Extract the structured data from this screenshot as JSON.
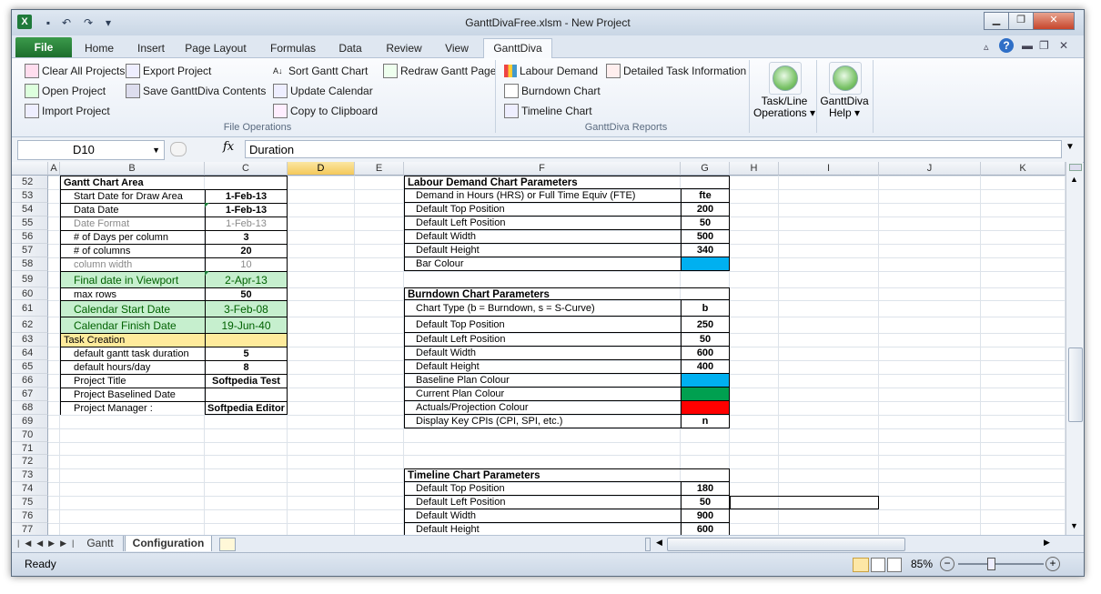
{
  "window": {
    "title": "GanttDivaFree.xlsm  -  New Project"
  },
  "ribbon_tabs": [
    "File",
    "Home",
    "Insert",
    "Page Layout",
    "Formulas",
    "Data",
    "Review",
    "View",
    "GanttDiva"
  ],
  "ribbon": {
    "file_ops": {
      "clear_all": "Clear All Projects",
      "open": "Open Project",
      "import": "Import Project",
      "export": "Export Project",
      "save_contents": "Save GanttDiva Contents",
      "sort": "Sort Gantt Chart",
      "update_calendar": "Update Calendar",
      "copy_clipboard": "Copy to Clipboard",
      "redraw": "Redraw Gantt Page",
      "group_label": "File Operations"
    },
    "reports": {
      "labour": "Labour Demand",
      "detailed": "Detailed Task Information",
      "burndown": "Burndown Chart",
      "timeline": "Timeline Chart",
      "group_label": "GanttDiva Reports"
    },
    "task_line": {
      "line1": "Task/Line",
      "line2": "Operations ▾"
    },
    "help": {
      "line1": "GanttDiva",
      "line2": "Help ▾"
    }
  },
  "formula_bar": {
    "name_box": "D10",
    "fx": "fx",
    "value": "Duration"
  },
  "columns": [
    "A",
    "B",
    "C",
    "D",
    "E",
    "F",
    "G",
    "H",
    "I",
    "J",
    "K"
  ],
  "rows": [
    "52",
    "53",
    "54",
    "55",
    "56",
    "57",
    "58",
    "59",
    "60",
    "61",
    "62",
    "63",
    "64",
    "65",
    "66",
    "67",
    "68",
    "69",
    "70",
    "71",
    "72",
    "73",
    "74",
    "75",
    "76",
    "77"
  ],
  "gantt_area": {
    "title": "Gantt Chart Area",
    "items": [
      {
        "label": "Start Date for Draw Area",
        "value": "1-Feb-13",
        "style": "normal"
      },
      {
        "label": "Data Date",
        "value": "1-Feb-13",
        "style": "normal"
      },
      {
        "label": "Date Format",
        "value": "1-Feb-13",
        "style": "grey"
      },
      {
        "label": "# of Days per column",
        "value": "3",
        "style": "normal"
      },
      {
        "label": "# of columns",
        "value": "20",
        "style": "normal"
      },
      {
        "label": "column width",
        "value": "10",
        "style": "grey"
      },
      {
        "label": "Final date in Viewport",
        "value": "2-Apr-13",
        "style": "green"
      },
      {
        "label": "max rows",
        "value": "50",
        "style": "normal"
      },
      {
        "label": "Calendar Start Date",
        "value": "3-Feb-08",
        "style": "green"
      },
      {
        "label": "Calendar Finish Date",
        "value": "19-Jun-40",
        "style": "green"
      },
      {
        "label": "Task Creation",
        "value": "",
        "style": "yellow"
      },
      {
        "label": "default gantt task duration",
        "value": "5",
        "style": "normal"
      },
      {
        "label": "default hours/day",
        "value": "8",
        "style": "normal"
      },
      {
        "label": "Project Title",
        "value": "Softpedia Test",
        "style": "normal"
      },
      {
        "label": "Project Baselined Date",
        "value": "",
        "style": "normal"
      },
      {
        "label": "Project Manager :",
        "value": "Softpedia Editor",
        "style": "normal"
      }
    ]
  },
  "labour": {
    "title": "Labour Demand Chart Parameters",
    "items": [
      {
        "label": "Demand in Hours (HRS) or Full Time Equiv (FTE)",
        "value": "fte"
      },
      {
        "label": "Default Top Position",
        "value": "200"
      },
      {
        "label": "Default Left Position",
        "value": "50"
      },
      {
        "label": "Default Width",
        "value": "500"
      },
      {
        "label": "Default Height",
        "value": "340"
      },
      {
        "label": "Bar Colour",
        "value": "",
        "color": "#00b0f0"
      }
    ]
  },
  "burndown": {
    "title": "Burndown Chart Parameters",
    "items": [
      {
        "label": "Chart Type (b = Burndown, s = S-Curve)",
        "value": "b"
      },
      {
        "label": "Default Top Position",
        "value": "250"
      },
      {
        "label": "Default Left Position",
        "value": "50"
      },
      {
        "label": "Default Width",
        "value": "600"
      },
      {
        "label": "Default Height",
        "value": "400"
      },
      {
        "label": "Baseline Plan Colour",
        "value": "",
        "color": "#00b0f0"
      },
      {
        "label": "Current Plan Colour",
        "value": "",
        "color": "#00a050"
      },
      {
        "label": "Actuals/Projection Colour",
        "value": "",
        "color": "#ff0000"
      },
      {
        "label": "Display Key CPIs (CPI, SPI, etc.)",
        "value": "n"
      }
    ]
  },
  "timeline": {
    "title": "Timeline Chart Parameters",
    "items": [
      {
        "label": "Default Top Position",
        "value": "180"
      },
      {
        "label": "Default Left Position",
        "value": "50"
      },
      {
        "label": "Default Width",
        "value": "900"
      },
      {
        "label": "Default Height",
        "value": "600"
      }
    ]
  },
  "sheets": [
    "Gantt",
    "Configuration"
  ],
  "status": {
    "text": "Ready",
    "zoom": "85%"
  }
}
